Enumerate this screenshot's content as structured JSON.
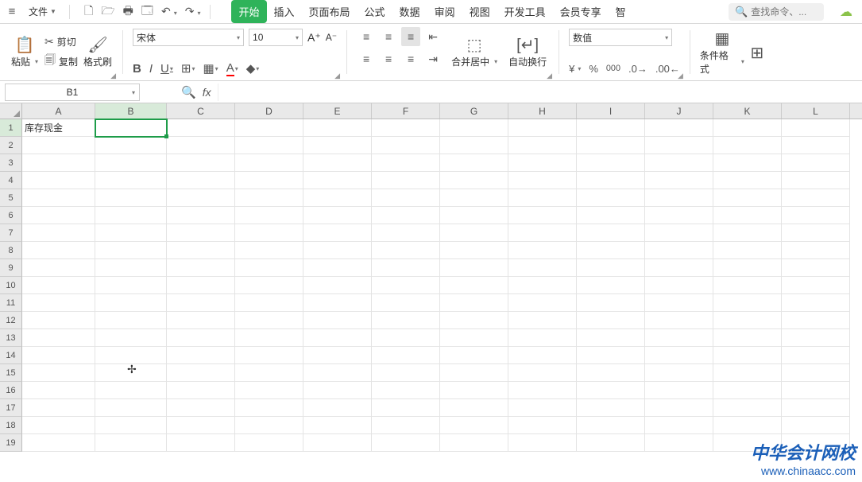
{
  "menubar": {
    "file_label": "文件",
    "search_placeholder": "查找命令、..."
  },
  "tabs": [
    "开始",
    "插入",
    "页面布局",
    "公式",
    "数据",
    "审阅",
    "视图",
    "开发工具",
    "会员专享",
    "智"
  ],
  "active_tab": 0,
  "clipboard": {
    "paste": "粘贴",
    "cut": "剪切",
    "copy": "复制",
    "format_painter": "格式刷"
  },
  "font": {
    "name": "宋体",
    "size": "10"
  },
  "alignment": {
    "merge_center": "合并居中",
    "wrap_text": "自动换行"
  },
  "number": {
    "format": "数值"
  },
  "cond_format": "条件格式",
  "namebox": "B1",
  "formula": "",
  "columns": [
    "A",
    "B",
    "C",
    "D",
    "E",
    "F",
    "G",
    "H",
    "I",
    "J",
    "K",
    "L"
  ],
  "row_count": 19,
  "active_cell": {
    "col": 1,
    "row": 0
  },
  "cells": {
    "A1": "库存现金"
  },
  "watermark": {
    "line1": "中华会计网校",
    "line2": "www.chinaacc.com"
  }
}
